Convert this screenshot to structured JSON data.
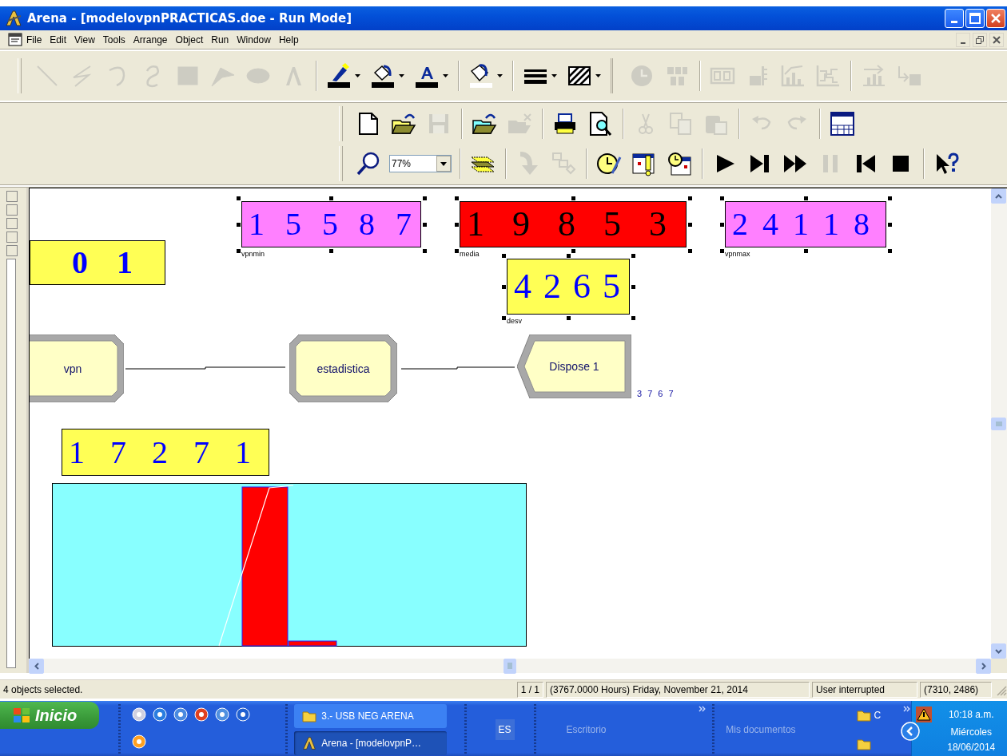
{
  "window": {
    "title": "Arena - [modelovpnPRACTICAS.doe - Run Mode]"
  },
  "menu": [
    "File",
    "Edit",
    "View",
    "Tools",
    "Arrange",
    "Object",
    "Run",
    "Window",
    "Help"
  ],
  "toolbars": {
    "drawing": [
      {
        "disabled": true
      },
      {
        "disabled": true
      },
      {
        "disabled": true
      },
      {
        "disabled": true
      },
      {
        "disabled": true
      },
      {
        "disabled": true
      },
      {
        "disabled": true
      },
      {
        "disabled": true
      },
      {
        "disabled": false
      },
      {
        "disabled": false
      },
      {
        "disabled": false
      },
      {
        "disabled": false
      },
      {
        "disabled": false
      },
      {
        "disabled": false
      },
      {
        "disabled": true
      },
      {
        "disabled": true
      },
      {
        "disabled": true
      },
      {
        "disabled": true
      },
      {
        "disabled": true
      },
      {
        "disabled": true
      },
      {
        "disabled": true
      },
      {
        "disabled": true
      }
    ],
    "standard": [
      {
        "disabled": false
      },
      {
        "disabled": false
      },
      {
        "disabled": true
      },
      {
        "disabled": false
      },
      {
        "disabled": true
      },
      {
        "disabled": false
      },
      {
        "disabled": false
      },
      {
        "disabled": true
      },
      {
        "disabled": true
      },
      {
        "disabled": true
      },
      {
        "disabled": true
      },
      {
        "disabled": true
      },
      {
        "disabled": false
      }
    ],
    "run": [
      {
        "disabled": false
      },
      {
        "disabled": false
      },
      {
        "disabled": true
      },
      {
        "disabled": true
      },
      {
        "disabled": false
      },
      {
        "disabled": false
      },
      {
        "disabled": false
      },
      {
        "disabled": false
      },
      {
        "disabled": false
      },
      {
        "disabled": false
      },
      {
        "disabled": true
      },
      {
        "disabled": false
      },
      {
        "disabled": false
      },
      {
        "disabled": false
      }
    ]
  },
  "zoom": {
    "value": "77%"
  },
  "canvas": {
    "displays": [
      {
        "label": "vpnmin",
        "value": "1 5 5 8 7",
        "color": "#ff80ff",
        "selected": true
      },
      {
        "label": "media",
        "value": "1 9 8 5 3",
        "color": "#ff0000",
        "selected": true
      },
      {
        "label": "vpnmax",
        "value": "2 4 1 1 8",
        "color": "#ff80ff",
        "selected": true
      },
      {
        "value": "0 1",
        "color": "#ffff55",
        "selected": false
      },
      {
        "label": "desv",
        "value": "4 2 6 5",
        "color": "#ffff55",
        "selected": true
      },
      {
        "value": "1 7 2 7 1",
        "color": "#ffff55",
        "selected": false
      }
    ],
    "modules": [
      {
        "kind": "create",
        "name": "vpn"
      },
      {
        "kind": "record",
        "name": "estadistica"
      },
      {
        "kind": "dispose",
        "name": "Dispose 1",
        "count": "3 7 6 7"
      }
    ]
  },
  "status_bar": {
    "message": "4 objects selected.",
    "page": "1 / 1",
    "time": "(3767.0000 Hours) Friday, November 21, 2014",
    "state": "User interrupted",
    "coords": "(7310, 2486)"
  },
  "taskbar": {
    "start": "Inicio",
    "tasks": [
      {
        "label": "3.- USB NEG ARENA",
        "selected": false
      },
      {
        "label": "Arena - [modelovpnP…",
        "selected": true
      }
    ],
    "language": "ES",
    "toolbars": [
      "Escritorio",
      "Mis documentos"
    ],
    "folder": "C",
    "clock": {
      "time": "10:18 a.m.",
      "day": "Miércoles",
      "date": "18/06/2014"
    }
  }
}
